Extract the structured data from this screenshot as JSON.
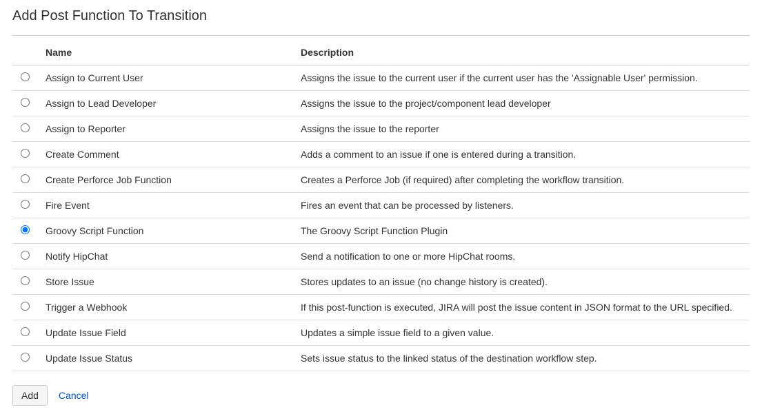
{
  "page": {
    "title": "Add Post Function To Transition"
  },
  "table": {
    "headers": {
      "name": "Name",
      "description": "Description"
    },
    "rows": [
      {
        "name": "Assign to Current User",
        "description": "Assigns the issue to the current user if the current user has the 'Assignable User' permission.",
        "selected": false
      },
      {
        "name": "Assign to Lead Developer",
        "description": "Assigns the issue to the project/component lead developer",
        "selected": false
      },
      {
        "name": "Assign to Reporter",
        "description": "Assigns the issue to the reporter",
        "selected": false
      },
      {
        "name": "Create Comment",
        "description": "Adds a comment to an issue if one is entered during a transition.",
        "selected": false
      },
      {
        "name": "Create Perforce Job Function",
        "description": "Creates a Perforce Job (if required) after completing the workflow transition.",
        "selected": false
      },
      {
        "name": "Fire Event",
        "description": "Fires an event that can be processed by listeners.",
        "selected": false
      },
      {
        "name": "Groovy Script Function",
        "description": "The Groovy Script Function Plugin",
        "selected": true
      },
      {
        "name": "Notify HipChat",
        "description": "Send a notification to one or more HipChat rooms.",
        "selected": false
      },
      {
        "name": "Store Issue",
        "description": "Stores updates to an issue (no change history is created).",
        "selected": false
      },
      {
        "name": "Trigger a Webhook",
        "description": "If this post-function is executed, JIRA will post the issue content in JSON format to the URL specified.",
        "selected": false
      },
      {
        "name": "Update Issue Field",
        "description": "Updates a simple issue field to a given value.",
        "selected": false
      },
      {
        "name": "Update Issue Status",
        "description": "Sets issue status to the linked status of the destination workflow step.",
        "selected": false
      }
    ]
  },
  "actions": {
    "add_label": "Add",
    "cancel_label": "Cancel"
  }
}
